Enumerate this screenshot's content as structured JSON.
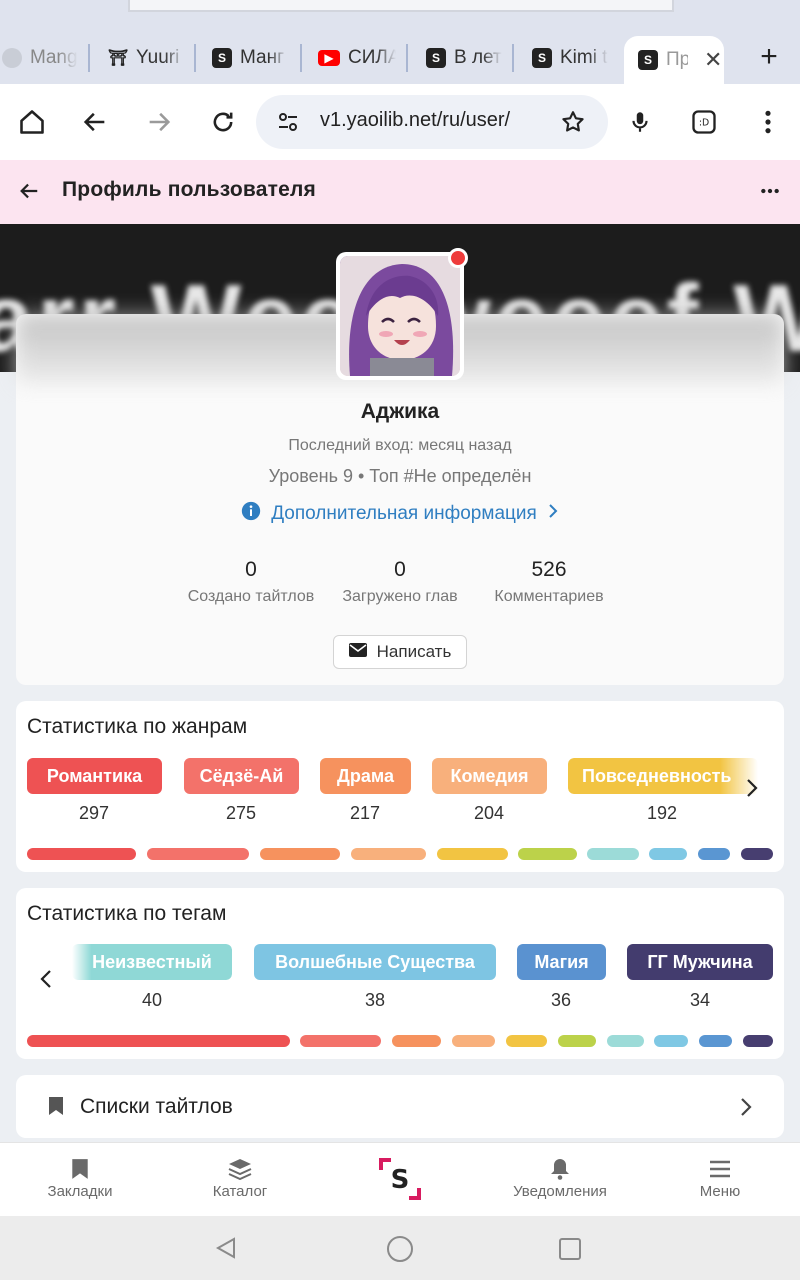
{
  "browser": {
    "tabs": [
      {
        "title": "Mang",
        "favicon": "globe-icon"
      },
      {
        "title": "Yuuri",
        "favicon": "yuuri-icon"
      },
      {
        "title": "Манг",
        "favicon": "slib-icon"
      },
      {
        "title": "СИЛА",
        "favicon": "youtube-icon"
      },
      {
        "title": "В лет",
        "favicon": "slib-icon"
      },
      {
        "title": "Kimi t",
        "favicon": "slib-icon"
      },
      {
        "title": "Пр",
        "favicon": "slib-icon",
        "active": true
      }
    ],
    "url": "v1.yaoilib.net/ru/user/",
    "colors": {
      "tabbar": "#dfe3ee",
      "urlbox": "#eef1f7"
    }
  },
  "header": {
    "title": "Профиль пользователя"
  },
  "profile": {
    "username": "Аджика",
    "last_login": "Последний вход: месяц назад",
    "level": "Уровень 9 • Топ #Не определён",
    "more_info": "Дополнительная информация",
    "stats": [
      {
        "value": "0",
        "label": "Создано тайтлов"
      },
      {
        "value": "0",
        "label": "Загружено глав"
      },
      {
        "value": "526",
        "label": "Комментариев"
      }
    ],
    "write_button": "Написать",
    "online_dot_color": "#ee3b3b"
  },
  "genres": {
    "title": "Статистика по жанрам",
    "items": [
      {
        "name": "Романтика",
        "count": "297",
        "color": "#ee5253"
      },
      {
        "name": "Сёдзё-Ай",
        "count": "275",
        "color": "#f3726a"
      },
      {
        "name": "Драма",
        "count": "217",
        "color": "#f6925e"
      },
      {
        "name": "Комедия",
        "count": "204",
        "color": "#f8b07c"
      },
      {
        "name": "Повседневность",
        "count": "192",
        "color": "#f2c442"
      }
    ],
    "bar_colors": [
      "#ee5253",
      "#f3726a",
      "#f6925e",
      "#f8b07c",
      "#f2c442",
      "#bcd24a",
      "#9cdbd8",
      "#7fc8e4",
      "#5a96d2",
      "#473e70"
    ]
  },
  "tags": {
    "title": "Статистика по тегам",
    "items": [
      {
        "name": "Неизвестный",
        "count": "40",
        "color": "#8fd8d6"
      },
      {
        "name": "Волшебные Существа",
        "count": "38",
        "color": "#7ec5e3"
      },
      {
        "name": "Магия",
        "count": "36",
        "color": "#5a92d0"
      },
      {
        "name": "ГГ Мужчина",
        "count": "34",
        "color": "#433c6e"
      }
    ],
    "bar_colors": [
      "#ee5253",
      "#f3726a",
      "#f6925e",
      "#f8b07c",
      "#f2c442",
      "#bcd24a",
      "#9cdbd8",
      "#7fc8e4",
      "#5a96d2",
      "#473e70"
    ]
  },
  "lists": {
    "label": "Списки тайтлов"
  },
  "bottom_nav": [
    {
      "label": "Закладки",
      "icon": "bookmark-icon"
    },
    {
      "label": "Каталог",
      "icon": "layers-icon"
    },
    {
      "label": "",
      "icon": "slib-logo-icon"
    },
    {
      "label": "Уведомления",
      "icon": "bell-icon"
    },
    {
      "label": "Меню",
      "icon": "menu-icon"
    }
  ]
}
